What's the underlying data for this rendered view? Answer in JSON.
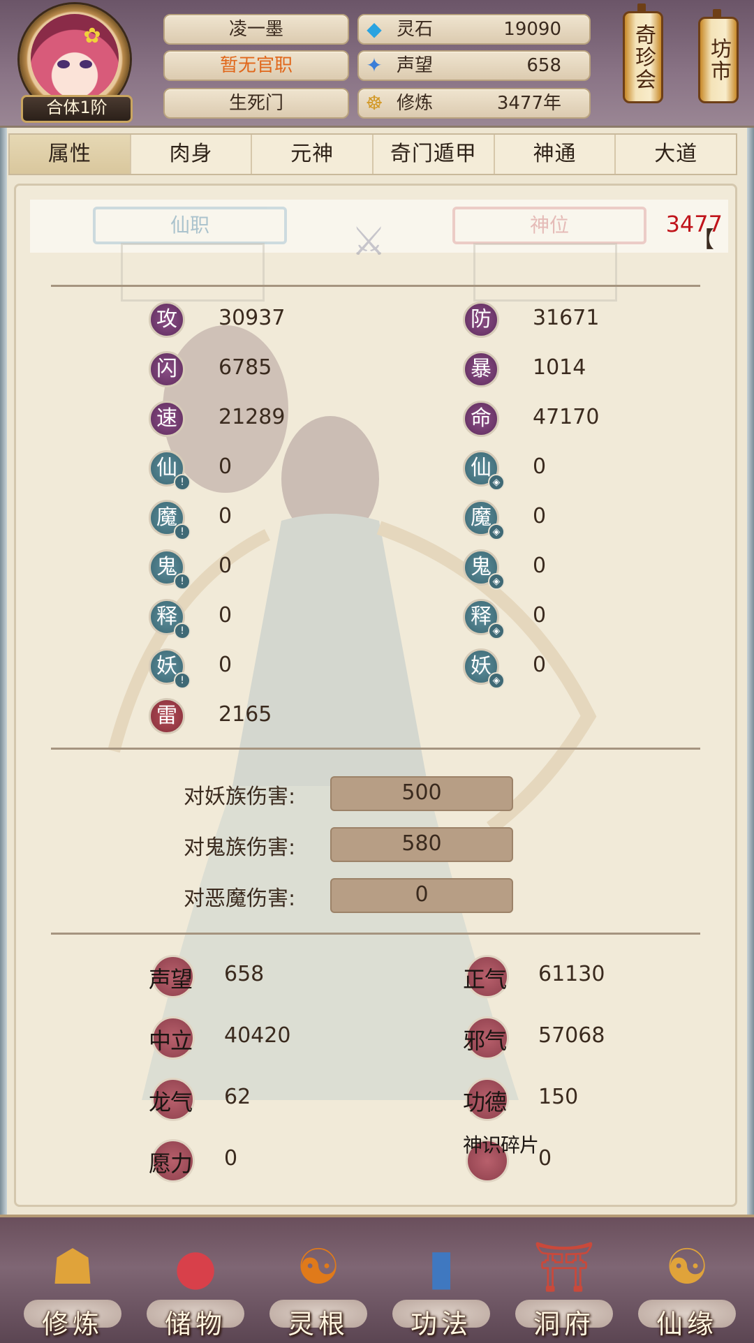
{
  "header": {
    "name": "凌一墨",
    "official_title": "暂无官职",
    "sect": "生死门",
    "rank": "合体1阶",
    "resources": [
      {
        "icon": "spirit-stone-icon",
        "glyph": "◆",
        "color": "#2aa3e0",
        "label": "灵石",
        "value": "19090"
      },
      {
        "icon": "reputation-icon",
        "glyph": "✦",
        "color": "#3b7ed8",
        "label": "声望",
        "value": "658"
      },
      {
        "icon": "meditation-icon",
        "glyph": "☸",
        "color": "#d39a2a",
        "label": "修炼",
        "value": "3477年"
      }
    ],
    "lanterns": [
      "奇珍会",
      "坊市"
    ]
  },
  "tabs": [
    "属性",
    "肉身",
    "元神",
    "奇门遁甲",
    "神通",
    "大道"
  ],
  "active_tab": "属性",
  "ticker": {
    "bracket": "【",
    "text": "3477"
  },
  "plaques": {
    "left": "仙职",
    "right": "神位"
  },
  "stats_left": [
    {
      "char": "攻",
      "value": "30937",
      "style": "purple",
      "mini": false
    },
    {
      "char": "闪",
      "value": "6785",
      "style": "purple",
      "mini": false
    },
    {
      "char": "速",
      "value": "21289",
      "style": "purple",
      "mini": false
    },
    {
      "char": "仙",
      "value": "0",
      "style": "teal",
      "mini": "!"
    },
    {
      "char": "魔",
      "value": "0",
      "style": "teal",
      "mini": "!"
    },
    {
      "char": "鬼",
      "value": "0",
      "style": "teal",
      "mini": "!"
    },
    {
      "char": "释",
      "value": "0",
      "style": "teal",
      "mini": "!"
    },
    {
      "char": "妖",
      "value": "0",
      "style": "teal",
      "mini": "!"
    },
    {
      "char": "雷",
      "value": "2165",
      "style": "red",
      "mini": false
    }
  ],
  "stats_right": [
    {
      "char": "防",
      "value": "31671",
      "style": "purple",
      "mini": false
    },
    {
      "char": "暴",
      "value": "1014",
      "style": "purple",
      "mini": false
    },
    {
      "char": "命",
      "value": "47170",
      "style": "purple",
      "mini": false
    },
    {
      "char": "仙",
      "value": "0",
      "style": "teal",
      "mini": "◈"
    },
    {
      "char": "魔",
      "value": "0",
      "style": "teal",
      "mini": "◈"
    },
    {
      "char": "鬼",
      "value": "0",
      "style": "teal",
      "mini": "◈"
    },
    {
      "char": "释",
      "value": "0",
      "style": "teal",
      "mini": "◈"
    },
    {
      "char": "妖",
      "value": "0",
      "style": "teal",
      "mini": "◈"
    }
  ],
  "damage": [
    {
      "label": "对妖族伤害:",
      "value": "500"
    },
    {
      "label": "对鬼族伤害:",
      "value": "580"
    },
    {
      "label": "对恶魔伤害:",
      "value": "0"
    }
  ],
  "reputation_left": [
    {
      "label": "声望",
      "value": "658"
    },
    {
      "label": "中立",
      "value": "40420"
    },
    {
      "label": "龙气",
      "value": "62"
    },
    {
      "label": "愿力",
      "value": "0"
    }
  ],
  "reputation_right": [
    {
      "label": "正气",
      "value": "61130"
    },
    {
      "label": "邪气",
      "value": "57068"
    },
    {
      "label": "功德",
      "value": "150"
    },
    {
      "label": "神识碎片",
      "value": "0"
    }
  ],
  "bottom_nav": [
    {
      "label": "修炼",
      "icon": "cultivation-icon",
      "glyph": "☗",
      "color": "#e0a33a"
    },
    {
      "label": "储物",
      "icon": "storage-bag-icon",
      "glyph": "●",
      "color": "#d8404a"
    },
    {
      "label": "灵根",
      "icon": "spirit-root-icon",
      "glyph": "☯",
      "color": "#e07a1a"
    },
    {
      "label": "功法",
      "icon": "technique-book-icon",
      "glyph": "▮",
      "color": "#3f78c0"
    },
    {
      "label": "洞府",
      "icon": "cave-dwelling-icon",
      "glyph": "⛩",
      "color": "#c9493b"
    },
    {
      "label": "仙缘",
      "icon": "gourd-icon",
      "glyph": "☯",
      "color": "#e0a33a"
    }
  ]
}
